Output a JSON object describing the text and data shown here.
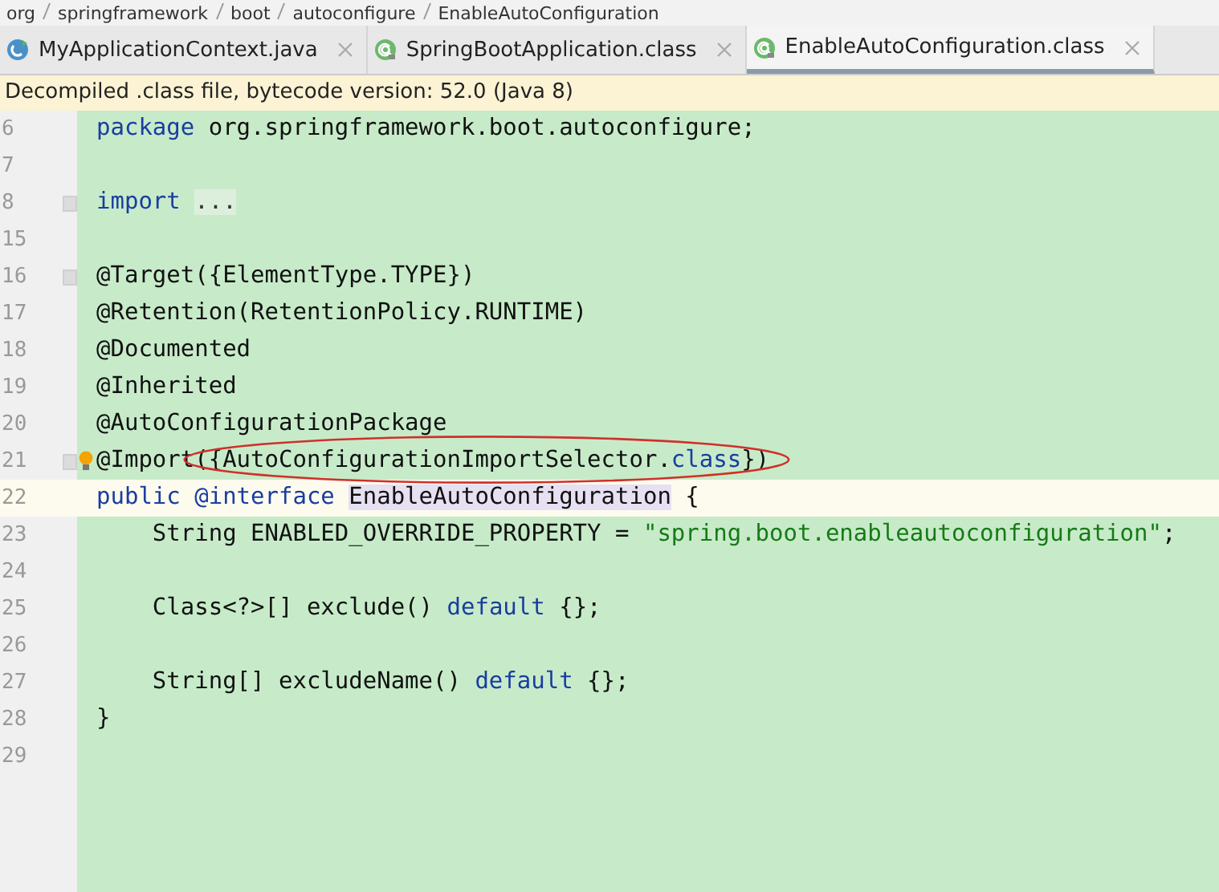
{
  "breadcrumb": [
    "org",
    "springframework",
    "boot",
    "autoconfigure",
    "EnableAutoConfiguration"
  ],
  "tabs": [
    {
      "label": "MyApplicationContext.java",
      "kind": "java",
      "selected": false
    },
    {
      "label": "SpringBootApplication.class",
      "kind": "annotation",
      "selected": false
    },
    {
      "label": "EnableAutoConfiguration.class",
      "kind": "annotation",
      "selected": true
    }
  ],
  "notice": "Decompiled .class file, bytecode version: 52.0 (Java 8)",
  "lines": [
    {
      "number": "6",
      "tokens": [
        {
          "text": "package",
          "kind": "keyword"
        },
        {
          "text": " org.springframework.boot.autoconfigure;",
          "kind": "plain"
        }
      ]
    },
    {
      "number": "7"
    },
    {
      "number": "8",
      "fold": true,
      "tokens": [
        {
          "text": "import ",
          "kind": "keyword"
        },
        {
          "text": "...",
          "kind": "folded"
        }
      ]
    },
    {
      "number": "15"
    },
    {
      "number": "16",
      "fold": true,
      "tokens": [
        {
          "text": "@Target({ElementType.TYPE})",
          "kind": "plain"
        }
      ]
    },
    {
      "number": "17",
      "tokens": [
        {
          "text": "@Retention(RetentionPolicy.RUNTIME)",
          "kind": "plain"
        }
      ]
    },
    {
      "number": "18",
      "tokens": [
        {
          "text": "@Documented",
          "kind": "plain"
        }
      ]
    },
    {
      "number": "19",
      "tokens": [
        {
          "text": "@Inherited",
          "kind": "plain"
        }
      ]
    },
    {
      "number": "20",
      "tokens": [
        {
          "text": "@AutoConfigurationPackage",
          "kind": "plain"
        }
      ]
    },
    {
      "number": "21",
      "fold": true,
      "bulb": true,
      "tokens": [
        {
          "text": "@Import",
          "kind": "plain"
        },
        {
          "text": "({AutoConfigurationImportSelector.",
          "kind": "plain",
          "circled": true
        },
        {
          "text": "class",
          "kind": "keyword",
          "circled": true
        },
        {
          "text": "})",
          "kind": "plain",
          "circled": true
        }
      ]
    },
    {
      "number": "22",
      "current": true,
      "tokens": [
        {
          "text": "public @interface ",
          "kind": "keyword"
        },
        {
          "text": "EnableAutoConfiguration",
          "kind": "highlighted"
        },
        {
          "text": " {",
          "kind": "plain"
        }
      ]
    },
    {
      "number": "23",
      "tokens": [
        {
          "text": "    String ENABLED_OVERRIDE_PROPERTY = ",
          "kind": "plain"
        },
        {
          "text": "\"spring.boot.enableautoconfiguration\"",
          "kind": "string"
        },
        {
          "text": ";",
          "kind": "plain"
        }
      ]
    },
    {
      "number": "24"
    },
    {
      "number": "25",
      "tokens": [
        {
          "text": "    Class<?>[] exclude() ",
          "kind": "plain"
        },
        {
          "text": "default",
          "kind": "keyword"
        },
        {
          "text": " {};",
          "kind": "plain"
        }
      ]
    },
    {
      "number": "26"
    },
    {
      "number": "27",
      "tokens": [
        {
          "text": "    String[] excludeName() ",
          "kind": "plain"
        },
        {
          "text": "default",
          "kind": "keyword"
        },
        {
          "text": " {};",
          "kind": "plain"
        }
      ]
    },
    {
      "number": "28",
      "tokens": [
        {
          "text": "}",
          "kind": "plain"
        }
      ]
    },
    {
      "number": "29"
    }
  ]
}
